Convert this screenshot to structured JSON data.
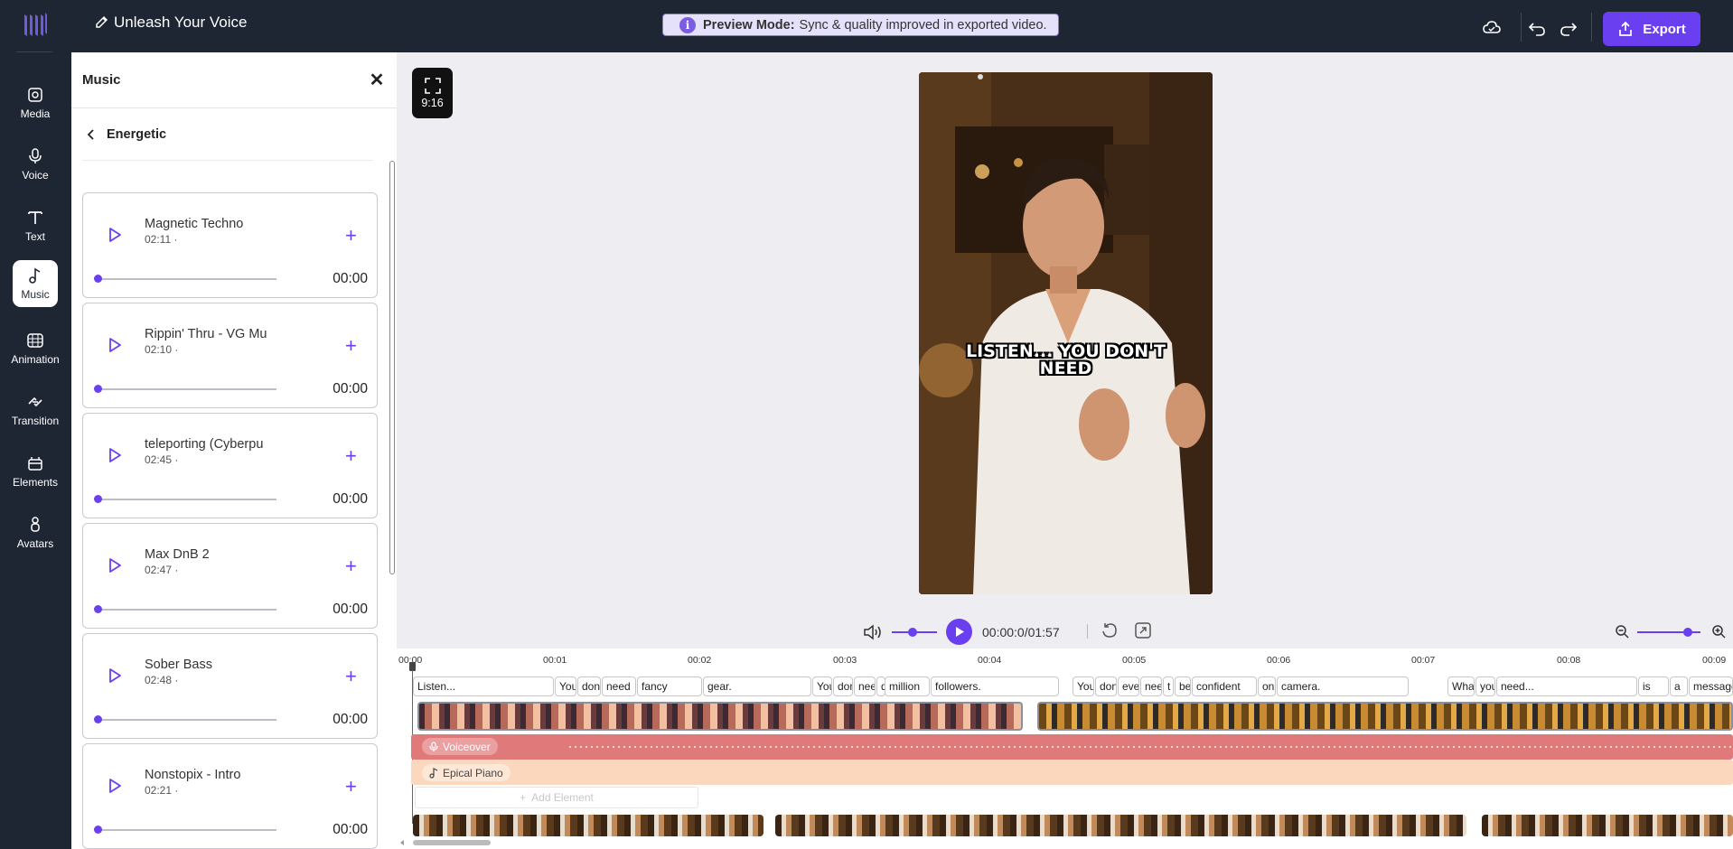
{
  "header": {
    "title": "Unleash Your Voice",
    "preview_label": "Preview Mode:",
    "preview_text": "Sync & quality improved in exported video.",
    "export_label": "Export"
  },
  "nav": {
    "items": [
      {
        "label": "Media",
        "icon": "media-icon"
      },
      {
        "label": "Voice",
        "icon": "microphone-icon"
      },
      {
        "label": "Text",
        "icon": "text-icon"
      },
      {
        "label": "Music",
        "icon": "music-icon",
        "active": true
      },
      {
        "label": "Animation",
        "icon": "animation-icon"
      },
      {
        "label": "Transition",
        "icon": "transition-icon"
      },
      {
        "label": "Elements",
        "icon": "elements-icon"
      },
      {
        "label": "Avatars",
        "icon": "avatar-icon"
      }
    ]
  },
  "panel": {
    "title": "Music",
    "category": "Energetic",
    "tracks": [
      {
        "name": "Magnetic Techno",
        "duration": "02:11 ·",
        "time": "00:00"
      },
      {
        "name": "Rippin' Thru - VG Mu",
        "duration": "02:10 ·",
        "time": "00:00"
      },
      {
        "name": "teleporting (Cyberpu",
        "duration": "02:45 ·",
        "time": "00:00"
      },
      {
        "name": "Max DnB 2",
        "duration": "02:47 ·",
        "time": "00:00"
      },
      {
        "name": "Sober Bass",
        "duration": "02:48 ·",
        "time": "00:00"
      },
      {
        "name": "Nonstopix - Intro",
        "duration": "02:21 ·",
        "time": "00:00"
      }
    ]
  },
  "stage": {
    "ratio": "9:16",
    "caption_line1": "LISTEN... YOU DON'T",
    "caption_line2": "NEED"
  },
  "player": {
    "time": "00:00:0/01:57",
    "volume": 0.45,
    "zoom": 0.75
  },
  "timeline": {
    "ruler": [
      "00:00",
      "00:01",
      "00:02",
      "00:03",
      "00:04",
      "00:05",
      "00:06",
      "00:07",
      "00:08",
      "00:09"
    ],
    "words": [
      "Listen...",
      "You",
      "don",
      "need",
      "fancy",
      "gear.",
      "You",
      "don",
      "nee",
      "d",
      "million",
      "followers.",
      "You",
      "don",
      "eve",
      "nee",
      "t",
      "be",
      "confident",
      "on",
      "camera.",
      "Wha",
      "you",
      "need...",
      "is",
      "a",
      "message"
    ],
    "voiceover_label": "Voiceover",
    "music_label": "Epical Piano",
    "add_element_label": "Add Element"
  },
  "colors": {
    "accent": "#6a3ff0",
    "topbar": "#1e2533",
    "voice_track": "#e07a7a",
    "music_track": "#fbd7bd"
  }
}
